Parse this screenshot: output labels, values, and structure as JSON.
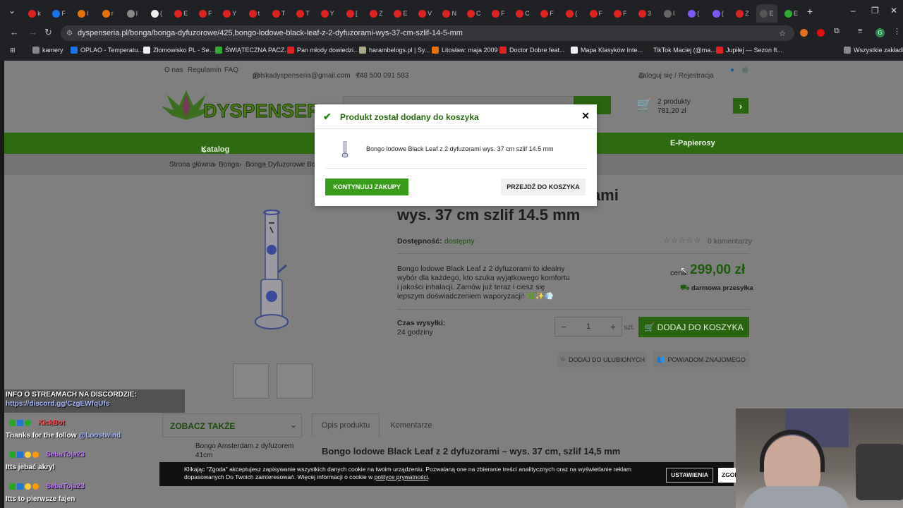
{
  "browser": {
    "url": "dyspenseria.pl/bonga/bonga-dyfuzorowe/425,bongo-lodowe-black-leaf-z-2-dyfuzorami-wys-37-cm-szlif-14-5-mm",
    "bookmarks": [
      "kamery",
      "OPLAO - Temperatu...",
      "Złomowisko PL - Se...",
      "ŚWIĄTECZNA PACZ...",
      "Pan młody dowiedzi...",
      "harambelogs.pl | Sy...",
      "Litosław: maja 2009",
      "Doctor Dobre feat...",
      "Mapa Klasyków Inte...",
      "TikTok Maciej (@ma...",
      "Jupiłej — Sezon ft..."
    ],
    "all_bookmarks": "Wszystkie zakładki",
    "tab_letters": [
      "k",
      "F",
      "I",
      "r",
      "I",
      "(",
      "E",
      "F",
      "Y",
      "t",
      "T",
      "T",
      "Y",
      "[",
      "Z",
      "E",
      "V",
      "N",
      "C",
      "F",
      "C",
      "F",
      "(",
      "F",
      "F",
      "3",
      "I",
      "(",
      "(",
      "Z",
      "E",
      "E"
    ]
  },
  "topbar": {
    "about": "O nas",
    "rules": "Regulamin",
    "faq": "FAQ",
    "email": "polskadyspenseria@gmail.com",
    "phone": "+48 500 091 583",
    "login": "Zaloguj się / Rejestracja"
  },
  "cart": {
    "count": "2 produkty",
    "total": "781,20 zł"
  },
  "nav": {
    "catalog": "Katalog produktów",
    "epapierosy": "E-Papierosy"
  },
  "breadcrumb": [
    "Strona główna",
    "Bonga",
    "Bonga Dyfuzorowe",
    "Bo"
  ],
  "product": {
    "title_line1": "z 2 dyfuzorami",
    "title_line2": "wys. 37 cm szlif 14.5 mm",
    "availability_label": "Dostępność:",
    "availability_value": "dostępny",
    "comments": "0 komentarzy",
    "description": "Bongo lodowe Black Leaf z 2 dyfuzorami to idealny wybór dla każdego, kto szuka wyjątkowego komfortu i jakości inhalacji. Zamów już teraz i ciesz się lepszym doświadczeniem waporyzacji! 🌿✨💨",
    "price_label": "cena:",
    "price": "299,00 zł",
    "free_shipping": "darmowa przesyłka",
    "shipping_time_label": "Czas wysyłki:",
    "shipping_time_value": "24 godziny",
    "quantity": "1",
    "unit": "szt.",
    "add_to_cart": "DODAJ DO KOSZYKA",
    "add_to_fav": "DODAJ DO ULUBIONYCH",
    "tell_friend": "POWIADOM ZNAJOMEGO"
  },
  "see_also": {
    "title": "ZOBACZ TAKŻE",
    "item": "Bongo Amsterdam z dyfuzorem 41cm"
  },
  "tabs": {
    "desc": "Opis produktu",
    "comments": "Komentarze"
  },
  "desc_heading": "Bongo lodowe Black Leaf z 2 dyfuzorami – wys. 37 cm, szlif 14,5 mm",
  "modal": {
    "title": "Produkt został dodany do koszyka",
    "product": "Bongo lodowe Black Leaf z 2 dyfuzorami wys. 37 cm szlif 14.5 mm",
    "continue": "KONTYNUUJ ZAKUPY",
    "go_cart": "PRZEJDŹ DO KOSZYKA"
  },
  "cookie": {
    "text": "Klikając \"Zgoda\" akceptujesz zapisywanie wszystkich danych cookie na twoim urządzeniu. Pozwalaną one na zbieranie treści analitycznych oraz na wyświetlanie reklam dopasowanych Do Twoich zainteresowań. Więcej informacji o cookie w ",
    "link": "polityce prywatności",
    "settings": "USTAWIENIA",
    "agree": "ZGOD"
  },
  "stream": {
    "info_title": "INFO O STREAMACH NA DISCORDZIE:",
    "info_link": "https://discord.gg/CzgEWfqUfs",
    "user1": "KickBot",
    "msg1a": "Thanks for the follow ",
    "msg1b": "@Loostwind",
    "user2": "SebaToja23",
    "msg2": "Itts jebać akryl",
    "user3": "SebaToja23",
    "msg3": "Itts to pierwsze fajen"
  }
}
